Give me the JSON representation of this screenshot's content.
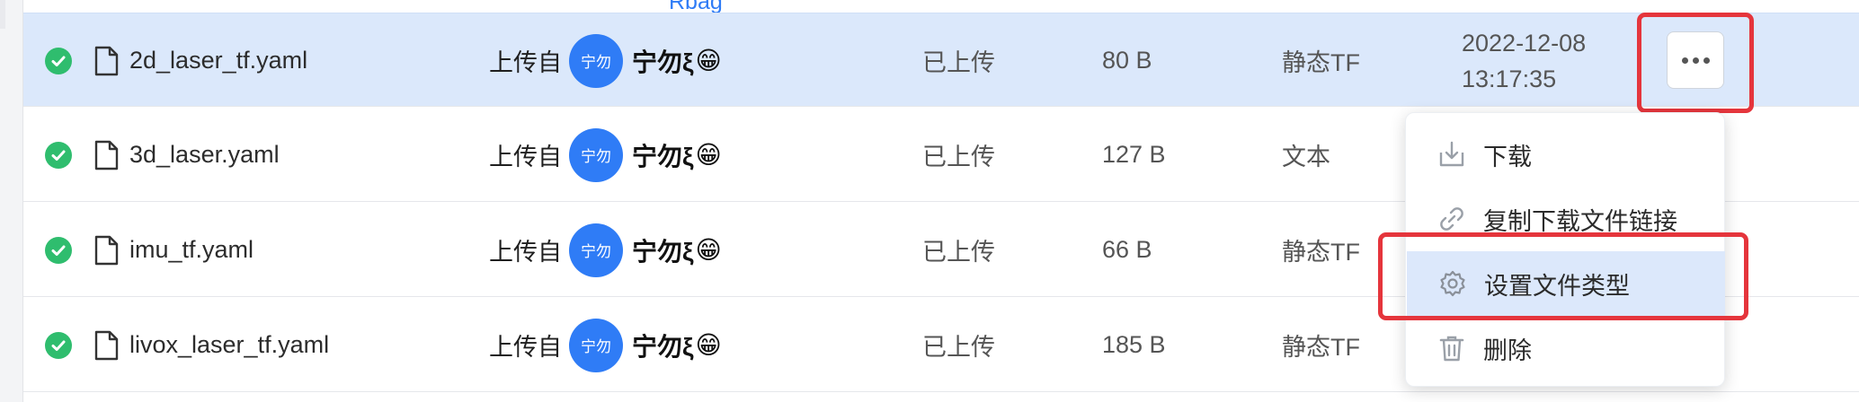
{
  "top_link": "Rbag",
  "rows": [
    {
      "name": "2d_laser_tf.yaml",
      "uploader_prefix": "上传自",
      "avatar_text": "宁勿",
      "uploader": "宁勿ξ",
      "emoji": "😁",
      "status": "已上传",
      "size": "80 B",
      "type": "静态TF",
      "date_line1": "2022-12-08",
      "date_line2": "13:17:35",
      "selected": true
    },
    {
      "name": "3d_laser.yaml",
      "uploader_prefix": "上传自",
      "avatar_text": "宁勿",
      "uploader": "宁勿ξ",
      "emoji": "😁",
      "status": "已上传",
      "size": "127 B",
      "type": "文本"
    },
    {
      "name": "imu_tf.yaml",
      "uploader_prefix": "上传自",
      "avatar_text": "宁勿",
      "uploader": "宁勿ξ",
      "emoji": "😁",
      "status": "已上传",
      "size": "66 B",
      "type": "静态TF"
    },
    {
      "name": "livox_laser_tf.yaml",
      "uploader_prefix": "上传自",
      "avatar_text": "宁勿",
      "uploader": "宁勿ξ",
      "emoji": "😁",
      "status": "已上传",
      "size": "185 B",
      "type": "静态TF"
    }
  ],
  "menu": {
    "items": [
      {
        "label": "下载",
        "icon": "download-icon"
      },
      {
        "label": "复制下载文件链接",
        "icon": "link-icon"
      },
      {
        "label": "设置文件类型",
        "icon": "gear-icon",
        "active": true
      },
      {
        "label": "删除",
        "icon": "trash-icon"
      }
    ]
  },
  "colors": {
    "accent": "#2f7cf6",
    "selected_row": "#dbe8fb",
    "success": "#2fbd6e",
    "highlight": "#e5353c"
  }
}
